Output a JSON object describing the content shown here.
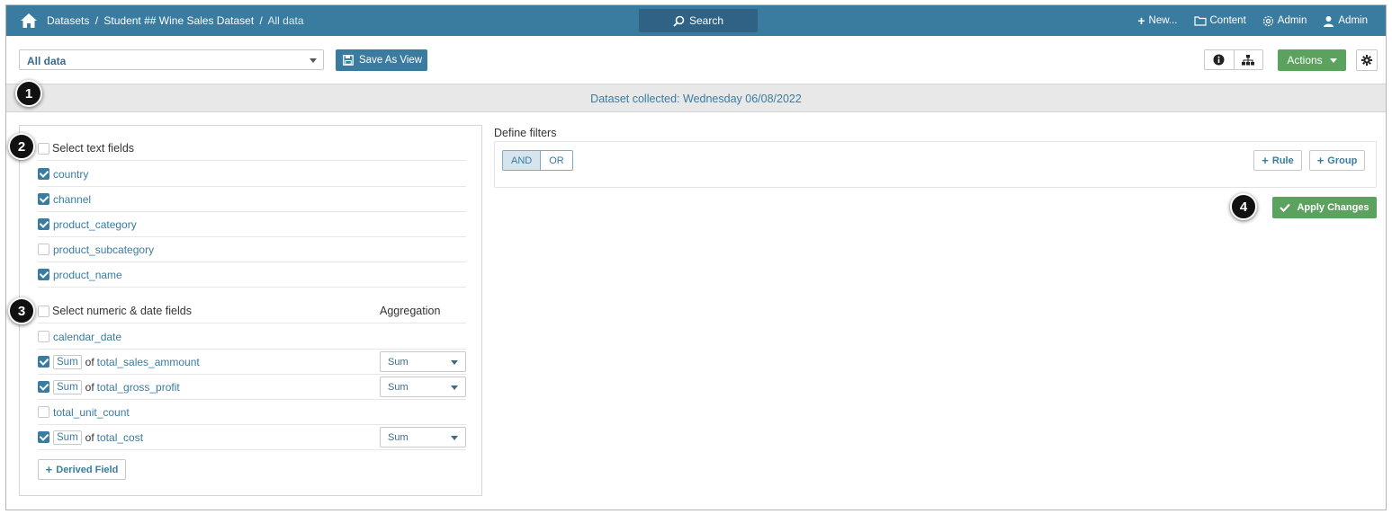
{
  "topbar": {
    "breadcrumb": [
      "Datasets",
      "Student ## Wine Sales Dataset"
    ],
    "current": "All data",
    "search_label": "Search",
    "new_label": "New...",
    "content_label": "Content",
    "admin_label": "Admin",
    "user_label": "Admin"
  },
  "toolbar": {
    "view_select_value": "All data",
    "save_view_label": "Save As View",
    "actions_label": "Actions"
  },
  "band": {
    "text": "Dataset collected: Wednesday 06/08/2022"
  },
  "text_fields": {
    "header": "Select text fields",
    "items": [
      {
        "name": "country",
        "checked": true
      },
      {
        "name": "channel",
        "checked": true
      },
      {
        "name": "product_category",
        "checked": true
      },
      {
        "name": "product_subcategory",
        "checked": false
      },
      {
        "name": "product_name",
        "checked": true
      }
    ]
  },
  "numeric_fields": {
    "header": "Select numeric & date fields",
    "aggregation_header": "Aggregation",
    "items": [
      {
        "name": "calendar_date",
        "checked": false
      },
      {
        "name": "total_sales_ammount",
        "checked": true,
        "chip": "Sum",
        "of": "of",
        "aggregation": "Sum"
      },
      {
        "name": "total_gross_profit",
        "checked": true,
        "chip": "Sum",
        "of": "of",
        "aggregation": "Sum"
      },
      {
        "name": "total_unit_count",
        "checked": false
      },
      {
        "name": "total_cost",
        "checked": true,
        "chip": "Sum",
        "of": "of",
        "aggregation": "Sum"
      }
    ],
    "derived_label": "Derived Field"
  },
  "filters": {
    "label": "Define filters",
    "and_label": "AND",
    "or_label": "OR",
    "rule_label": "Rule",
    "group_label": "Group",
    "apply_label": "Apply Changes"
  },
  "callouts": [
    "1",
    "2",
    "3",
    "4"
  ],
  "colors": {
    "topbar": "#3a7ba0",
    "accent": "#3a7ba0",
    "success": "#5aa25e",
    "band": "#e8e8e8"
  }
}
